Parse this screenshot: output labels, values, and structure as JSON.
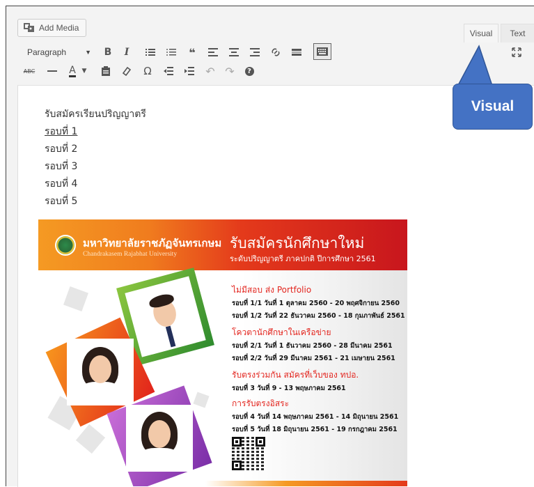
{
  "toolbar": {
    "add_media_label": "Add Media",
    "format_value": "Paragraph",
    "tabs": {
      "visual": "Visual",
      "text": "Text"
    }
  },
  "content": {
    "lines": [
      "รับสมัครเรียนปริญญาตรี",
      "รอบที่ 1",
      "รอบที่ 2",
      "รอบที่ 3",
      "รอบที่ 4",
      "รอบที่ 5"
    ]
  },
  "callout": {
    "label": "Visual"
  },
  "poster": {
    "university_th": "มหาวิทยาลัยราชภัฏจันทรเกษม",
    "university_en": "Chandrakasem Rajabhat University",
    "title": "รับสมัครนักศึกษาใหม่",
    "subtitle": "ระดับปริญญาตรี ภาคปกติ ปีการศึกษา 2561",
    "sections": [
      {
        "heading": "ไม่มีสอบ ส่ง Portfolio",
        "rows": [
          "รอบที่ 1/1 วันที่ 1 ตุลาคม 2560 - 20 พฤศจิกายน 2560",
          "รอบที่ 1/2 วันที่ 22 ธันวาคม 2560 - 18 กุมภาพันธ์ 2561"
        ]
      },
      {
        "heading": "โควตานักศึกษาในเครือข่าย",
        "rows": [
          "รอบที่ 2/1 วันที่ 1 ธันวาคม 2560 - 28 มีนาคม 2561",
          "รอบที่ 2/2 วันที่ 29 มีนาคม 2561 - 21 เมษายน 2561"
        ]
      },
      {
        "heading": "รับตรงร่วมกัน สมัครที่เว็บของ ทปอ.",
        "rows": [
          "รอบที่ 3 วันที่ 9 - 13 พฤษภาคม 2561"
        ]
      },
      {
        "heading": "การรับตรงอิสระ",
        "rows": [
          "รอบที่ 4 วันที่ 14 พฤษภาคม 2561 - 14 มิถุนายน 2561",
          "รอบที่ 5 วันที่ 18 มิถุนายน 2561 - 19 กรกฎาคม 2561"
        ]
      }
    ]
  },
  "colors": {
    "callout": "#4472c4",
    "poster_red": "#e3261f",
    "poster_orange": "#f59a23"
  }
}
